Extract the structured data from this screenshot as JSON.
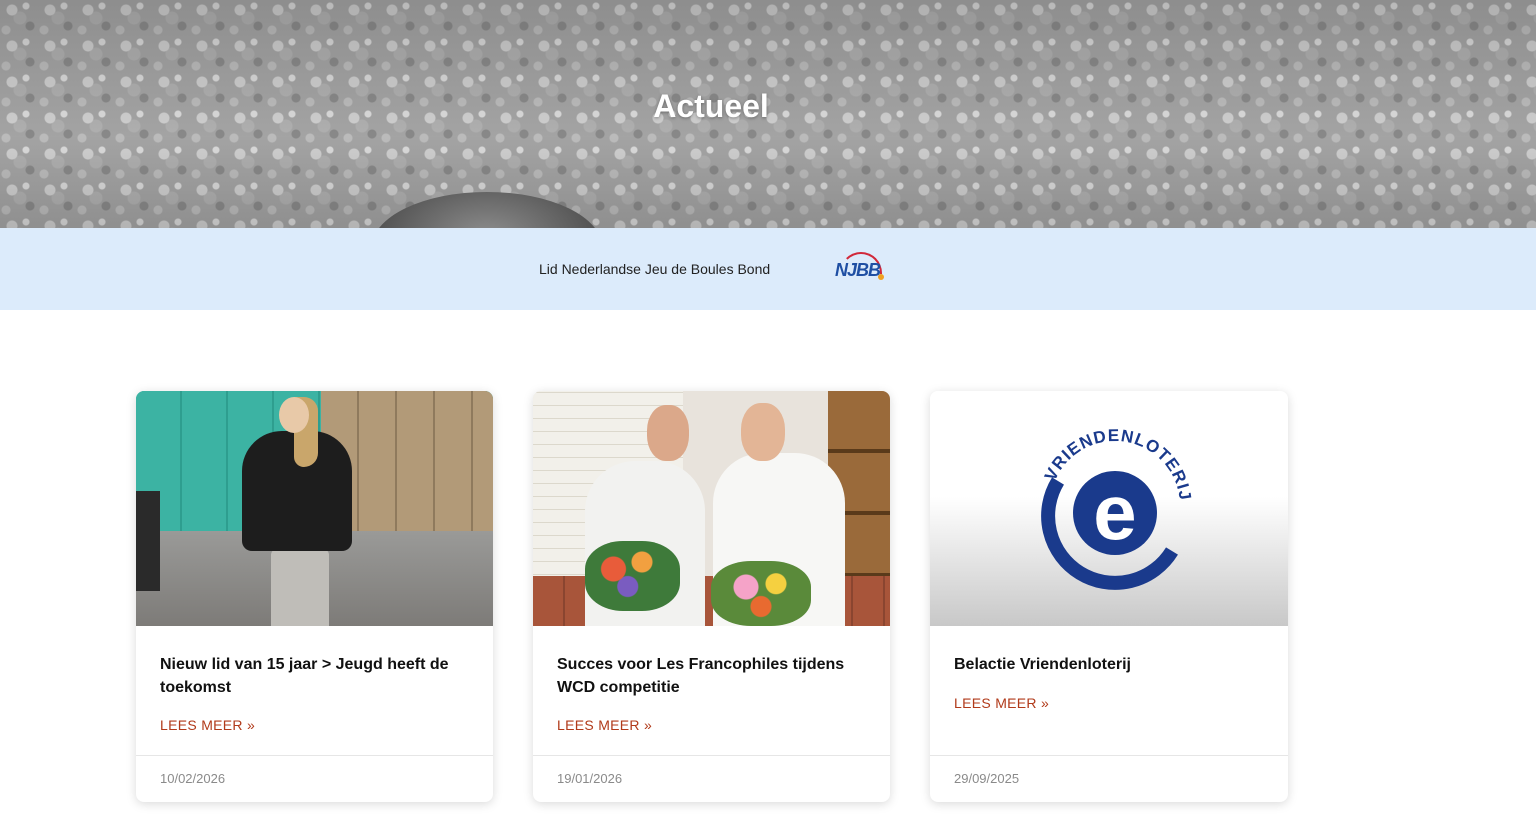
{
  "hero": {
    "title": "Actueel"
  },
  "band": {
    "text": "Lid Nederlandse Jeu de Boules Bond",
    "logo_text": "NJBB"
  },
  "cards": [
    {
      "title": "Nieuw lid van 15 jaar > Jeugd heeft de toekomst",
      "read_more": "LEES MEER »",
      "date": "10/02/2026"
    },
    {
      "title": "Succes voor Les Francophiles tijdens WCD competitie",
      "read_more": "LEES MEER »",
      "date": "19/01/2026"
    },
    {
      "title": "Belactie Vriendenloterij",
      "read_more": "LEES MEER »",
      "date": "29/09/2025",
      "logo_text": "VRIENDENLOTERIJ",
      "logo_letter": "e"
    }
  ],
  "colors": {
    "band_bg": "#dcebfb",
    "read_more": "#b13a1a",
    "vriendenloterij_blue": "#1a3a8c"
  }
}
